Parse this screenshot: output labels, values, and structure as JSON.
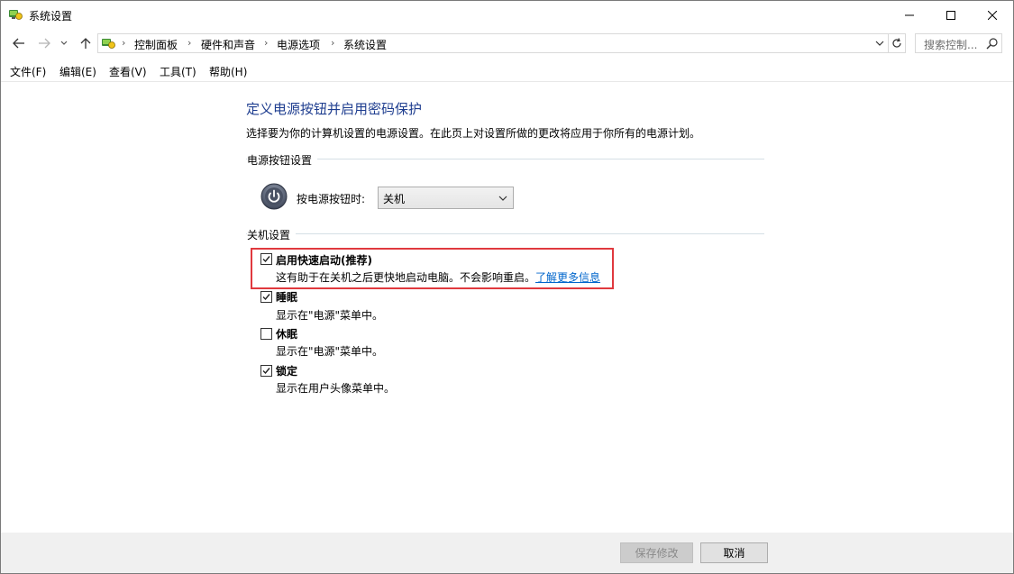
{
  "window": {
    "title": "系统设置"
  },
  "nav": {
    "breadcrumbs": [
      "控制面板",
      "硬件和声音",
      "电源选项",
      "系统设置"
    ],
    "search_placeholder": "搜索控制..."
  },
  "menu": [
    "文件(F)",
    "编辑(E)",
    "查看(V)",
    "工具(T)",
    "帮助(H)"
  ],
  "main": {
    "title": "定义电源按钮并启用密码保护",
    "description": "选择要为你的计算机设置的电源设置。在此页上对设置所做的更改将应用于你所有的电源计划。",
    "power_button_section": {
      "heading": "电源按钮设置",
      "label": "按电源按钮时:",
      "selected": "关机"
    },
    "shutdown_section": {
      "heading": "关机设置",
      "options": [
        {
          "label": "启用快速启动(推荐)",
          "checked": true,
          "description": "这有助于在关机之后更快地启动电脑。不会影响重启。",
          "link": "了解更多信息"
        },
        {
          "label": "睡眠",
          "checked": true,
          "description": "显示在\"电源\"菜单中。"
        },
        {
          "label": "休眠",
          "checked": false,
          "description": "显示在\"电源\"菜单中。"
        },
        {
          "label": "锁定",
          "checked": true,
          "description": "显示在用户头像菜单中。"
        }
      ]
    }
  },
  "footer": {
    "save_label": "保存修改",
    "cancel_label": "取消"
  },
  "colors": {
    "title_blue": "#1e3d8f",
    "link_blue": "#0066cc",
    "highlight_red": "#e0393e"
  }
}
